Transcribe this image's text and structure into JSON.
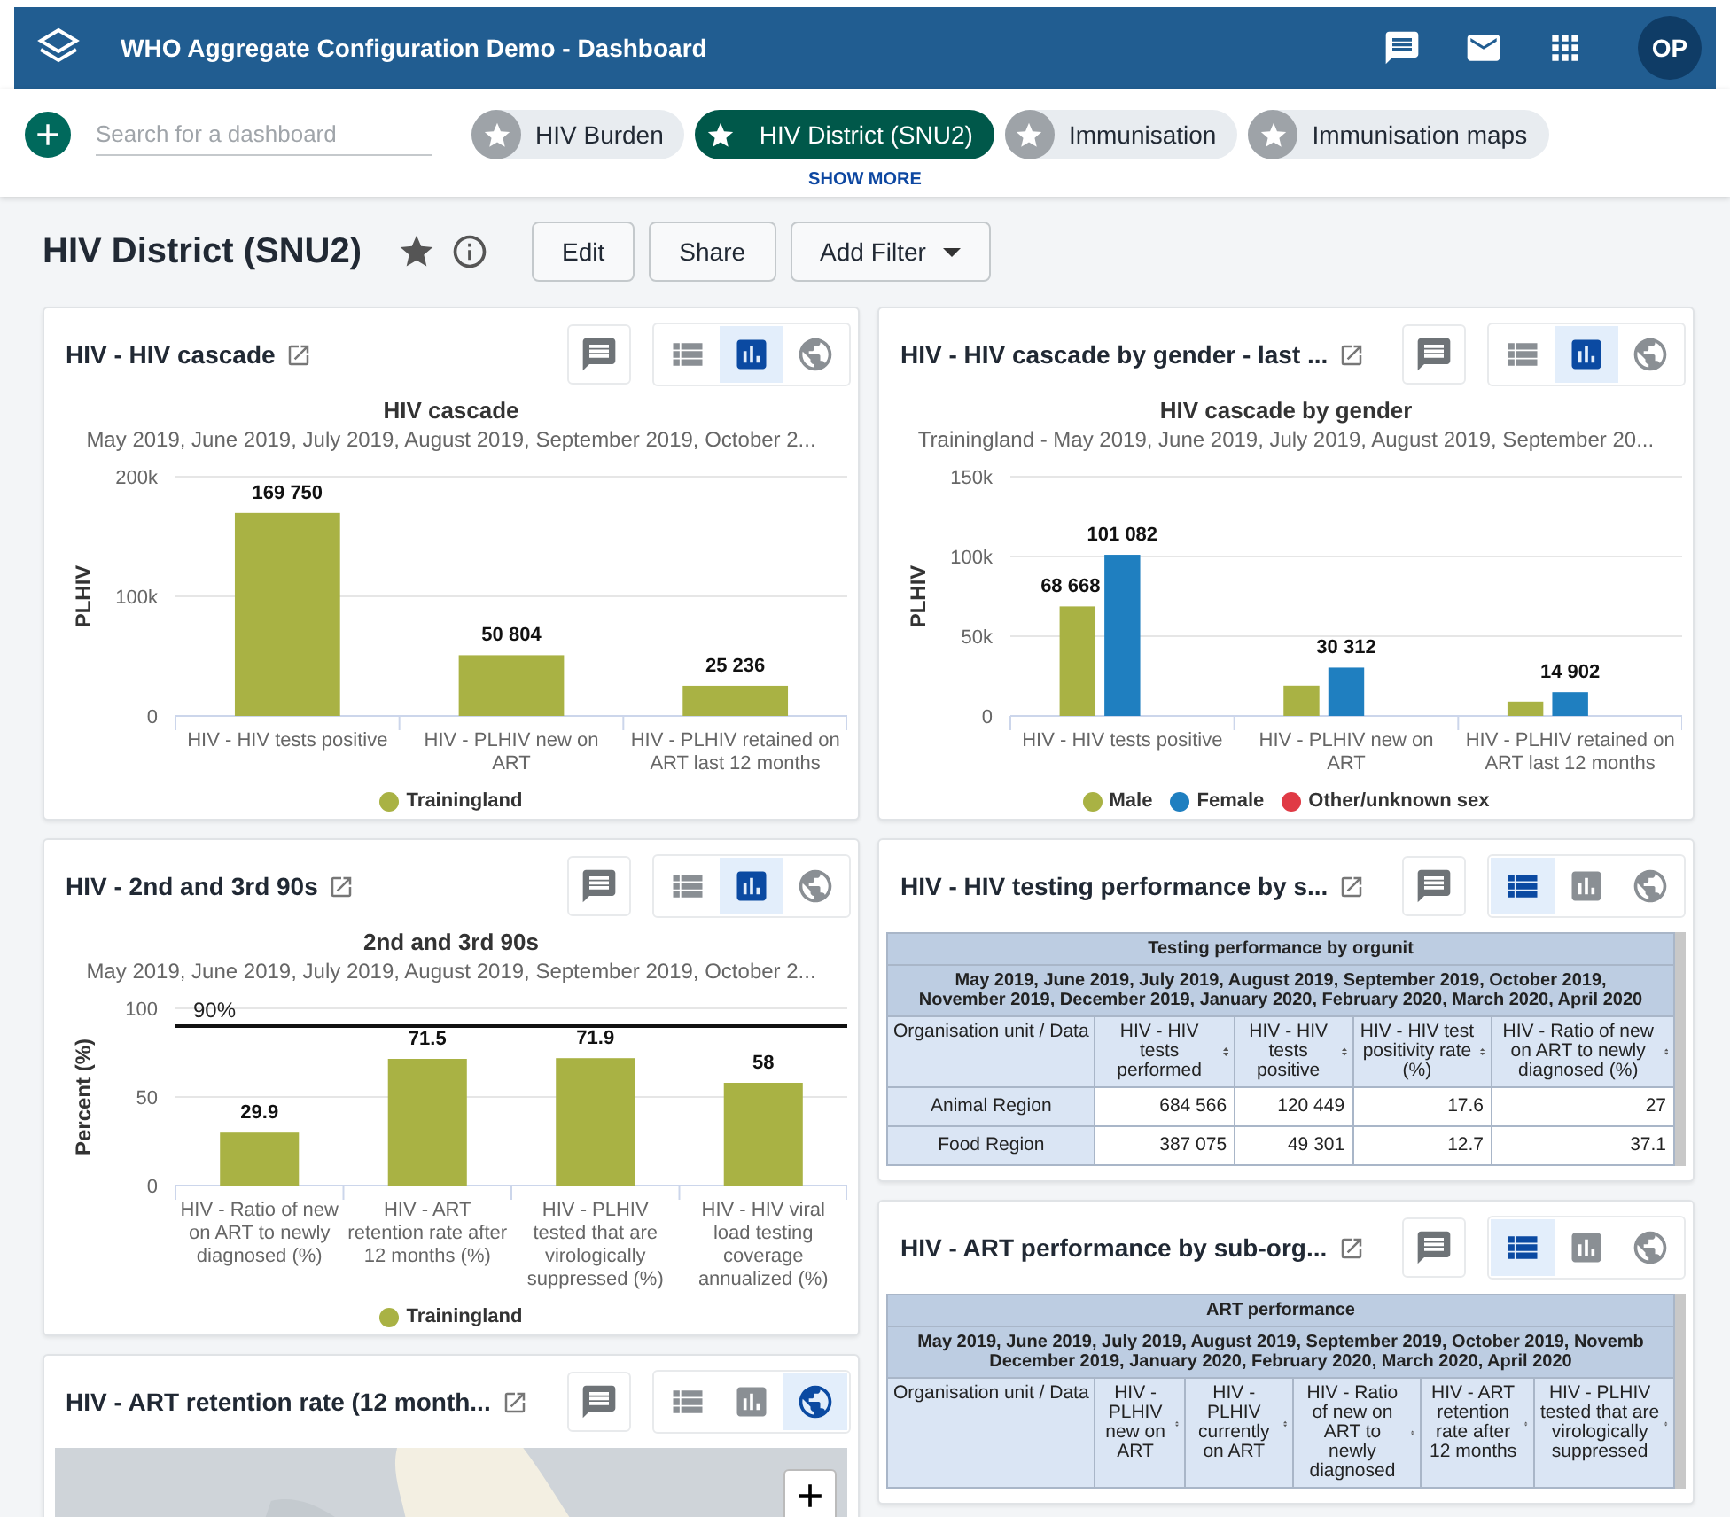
{
  "header": {
    "title": "WHO Aggregate Configuration Demo - Dashboard",
    "avatar": "OP"
  },
  "chips_bar": {
    "search": {
      "placeholder": "Search for a dashboard"
    },
    "chips": [
      {
        "label": "HIV Burden",
        "selected": false
      },
      {
        "label": "HIV District (SNU2)",
        "selected": true
      },
      {
        "label": "Immunisation",
        "selected": false
      },
      {
        "label": "Immunisation maps",
        "selected": false
      }
    ],
    "show_more": "SHOW MORE"
  },
  "dashboard": {
    "title": "HIV District (SNU2)",
    "buttons": [
      "Edit",
      "Share"
    ],
    "filter_button": "Add Filter"
  },
  "columns": [
    {
      "items": [
        {
          "kind": "chart",
          "title": "HIV - HIV cascade",
          "views": [
            {
              "kind": "table",
              "selected": false
            },
            {
              "kind": "chart",
              "selected": true
            },
            {
              "kind": "map",
              "selected": false
            }
          ],
          "subtitle": "May 2019, June 2019, July 2019, August 2019, September 2019, October 2...",
          "chart_data": {
            "type": "bar",
            "title": "HIV cascade",
            "ylabel": "PLHIV",
            "categories": [
              "HIV - HIV tests positive",
              "HIV - PLHIV new on ART",
              "HIV - PLHIV retained on ART last 12 months"
            ],
            "series": [
              {
                "name": "Trainingland",
                "color": "#a9b244",
                "values": [
                  169750,
                  50804,
                  25236
                ]
              }
            ],
            "ylim": [
              0,
              200000
            ],
            "yticks": [
              {
                "value": 0,
                "label": "0"
              },
              {
                "value": 100000,
                "label": "100k"
              },
              {
                "value": 200000,
                "label": "200k"
              }
            ],
            "value_labels": [
              [
                "169 750",
                "50 804",
                "25 236"
              ]
            ],
            "legend": "bottom"
          }
        },
        {
          "kind": "chart",
          "title": "HIV - 2nd and 3rd 90s",
          "views": [
            {
              "kind": "table",
              "selected": false
            },
            {
              "kind": "chart",
              "selected": true
            },
            {
              "kind": "map",
              "selected": false
            }
          ],
          "subtitle": "May 2019, June 2019, July 2019, August 2019, September 2019, October 2...",
          "chart_data": {
            "type": "bar",
            "title": "2nd and 3rd 90s",
            "ylabel": "Percent (%)",
            "categories": [
              "HIV - Ratio of new on ART to newly diagnosed (%)",
              "HIV - ART retention rate after 12 months (%)",
              "HIV - PLHIV tested that are virologically suppressed (%)",
              "HIV - HIV viral load testing coverage annualized (%)"
            ],
            "series": [
              {
                "name": "Trainingland",
                "color": "#a9b244",
                "values": [
                  29.9,
                  71.5,
                  71.9,
                  58
                ]
              }
            ],
            "ylim": [
              0,
              100
            ],
            "yticks": [
              0,
              50,
              100
            ],
            "value_labels": [
              [
                "29.9",
                "71.5",
                "71.9",
                "58"
              ]
            ],
            "ref_lines": [
              {
                "axis": "y",
                "value": 90,
                "label": "90%"
              }
            ],
            "legend": "bottom"
          }
        },
        {
          "kind": "map",
          "title": "HIV - ART retention rate (12 month...",
          "views": [
            {
              "kind": "table",
              "selected": false
            },
            {
              "kind": "chart",
              "selected": false
            },
            {
              "kind": "map",
              "selected": true
            }
          ]
        }
      ]
    },
    {
      "items": [
        {
          "kind": "chart",
          "title": "HIV - HIV cascade by gender - last ...",
          "views": [
            {
              "kind": "table",
              "selected": false
            },
            {
              "kind": "chart",
              "selected": true
            },
            {
              "kind": "map",
              "selected": false
            }
          ],
          "subtitle": "Trainingland - May 2019, June 2019, July 2019, August 2019, September 20...",
          "chart_data": {
            "type": "bar",
            "title": "HIV cascade by gender",
            "ylabel": "PLHIV",
            "categories": [
              "HIV - HIV tests positive",
              "HIV - PLHIV new on ART",
              "HIV - PLHIV retained on ART last 12 months"
            ],
            "series": [
              {
                "name": "Male",
                "color": "#a9b244",
                "values": [
                  68668,
                  19000,
                  9000
                ]
              },
              {
                "name": "Female",
                "color": "#1f7fc0",
                "values": [
                  101082,
                  30312,
                  14902
                ]
              },
              {
                "name": "Other/unknown sex",
                "color": "#e03a45",
                "values": [
                  null,
                  null,
                  null
                ]
              }
            ],
            "ylim": [
              0,
              150000
            ],
            "yticks": [
              {
                "value": 0,
                "label": "0"
              },
              {
                "value": 50000,
                "label": "50k"
              },
              {
                "value": 100000,
                "label": "100k"
              },
              {
                "value": 150000,
                "label": "150k"
              }
            ],
            "value_labels": [
              [
                "68 668",
                null,
                null
              ],
              [
                "101 082",
                "30 312",
                "14 902"
              ],
              [
                null,
                null,
                null
              ]
            ],
            "legend": "bottom"
          }
        },
        {
          "kind": "table",
          "title": "HIV - HIV testing performance by s...",
          "views": [
            {
              "kind": "table",
              "selected": true
            },
            {
              "kind": "chart",
              "selected": false
            },
            {
              "kind": "map",
              "selected": false
            }
          ],
          "table": {
            "title": "Testing performance by orgunit",
            "period_lines": [
              "May 2019, June 2019, July 2019, August 2019, September 2019, October 2019,",
              "November 2019, December 2019, January 2020, February 2020, March 2020, April 2020"
            ],
            "columns": [
              "Organisation unit / Data",
              "HIV - HIV tests performed",
              "HIV - HIV tests positive",
              "HIV - HIV test positivity rate (%)",
              "HIV - Ratio of new on ART to newly diagnosed (%)"
            ],
            "rows": [
              {
                "cells": [
                  "Animal Region",
                  "684 566",
                  "120 449",
                  "17.6",
                  "27"
                ]
              },
              {
                "cells": [
                  "Food Region",
                  "387 075",
                  "49 301",
                  "12.7",
                  "37.1"
                ]
              }
            ]
          }
        },
        {
          "kind": "table",
          "title": "HIV - ART performance by sub-org...",
          "views": [
            {
              "kind": "table",
              "selected": true
            },
            {
              "kind": "chart",
              "selected": false
            },
            {
              "kind": "map",
              "selected": false
            }
          ],
          "table": {
            "title": "ART performance",
            "period_lines": [
              "May 2019, June 2019, July 2019, August 2019, September 2019, October 2019, Novemb",
              "December 2019, January 2020, February 2020, March 2020, April 2020"
            ],
            "columns": [
              "Organisation unit / Data",
              "HIV - PLHIV new on ART",
              "HIV - PLHIV currently on ART",
              "HIV - Ratio of new on ART to newly diagnosed",
              "HIV - ART retention rate after 12 months",
              "HIV - PLHIV tested that are virologically suppressed"
            ]
          }
        }
      ]
    }
  ]
}
